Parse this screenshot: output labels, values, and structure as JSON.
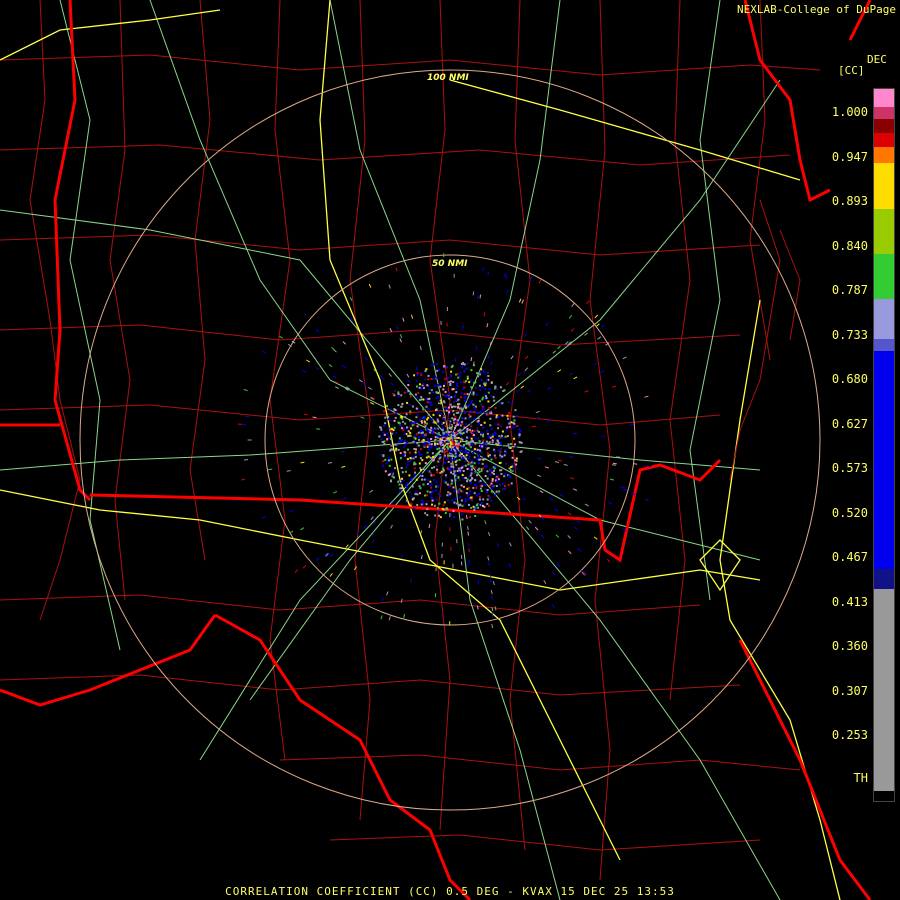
{
  "credit": "NEXLAB-College of DuPage",
  "units": {
    "line1": "DEC",
    "line2": "[CC]"
  },
  "footer": "CORRELATION COEFFICIENT (CC) 0.5 DEG - KVAX 15 DEC 25 13:53",
  "range_rings": [
    {
      "label": "100 NMI"
    },
    {
      "label": "50 NMI"
    }
  ],
  "colorbar": {
    "ticks": [
      "1.000",
      "0.947",
      "0.893",
      "0.840",
      "0.787",
      "0.733",
      "0.680",
      "0.627",
      "0.573",
      "0.520",
      "0.467",
      "0.413",
      "0.360",
      "0.307",
      "0.253",
      "TH"
    ],
    "colors": {
      "pink": "#ff88cc",
      "magenta": "#cc3366",
      "darkred": "#880000",
      "red": "#dd0000",
      "orange": "#ff7700",
      "yellow": "#ffdd00",
      "olive": "#99cc00",
      "green": "#33cc33",
      "lavender": "#9999dd",
      "blue": "#0000ee",
      "navy": "#111188",
      "gray": "#999999",
      "black": "#000000"
    }
  },
  "map_colors": {
    "state_border": "#ff0000",
    "county_border": "#aa1111",
    "highway": "#ffff44",
    "road": "#99ee99",
    "range_ring": "#ddaa88"
  }
}
